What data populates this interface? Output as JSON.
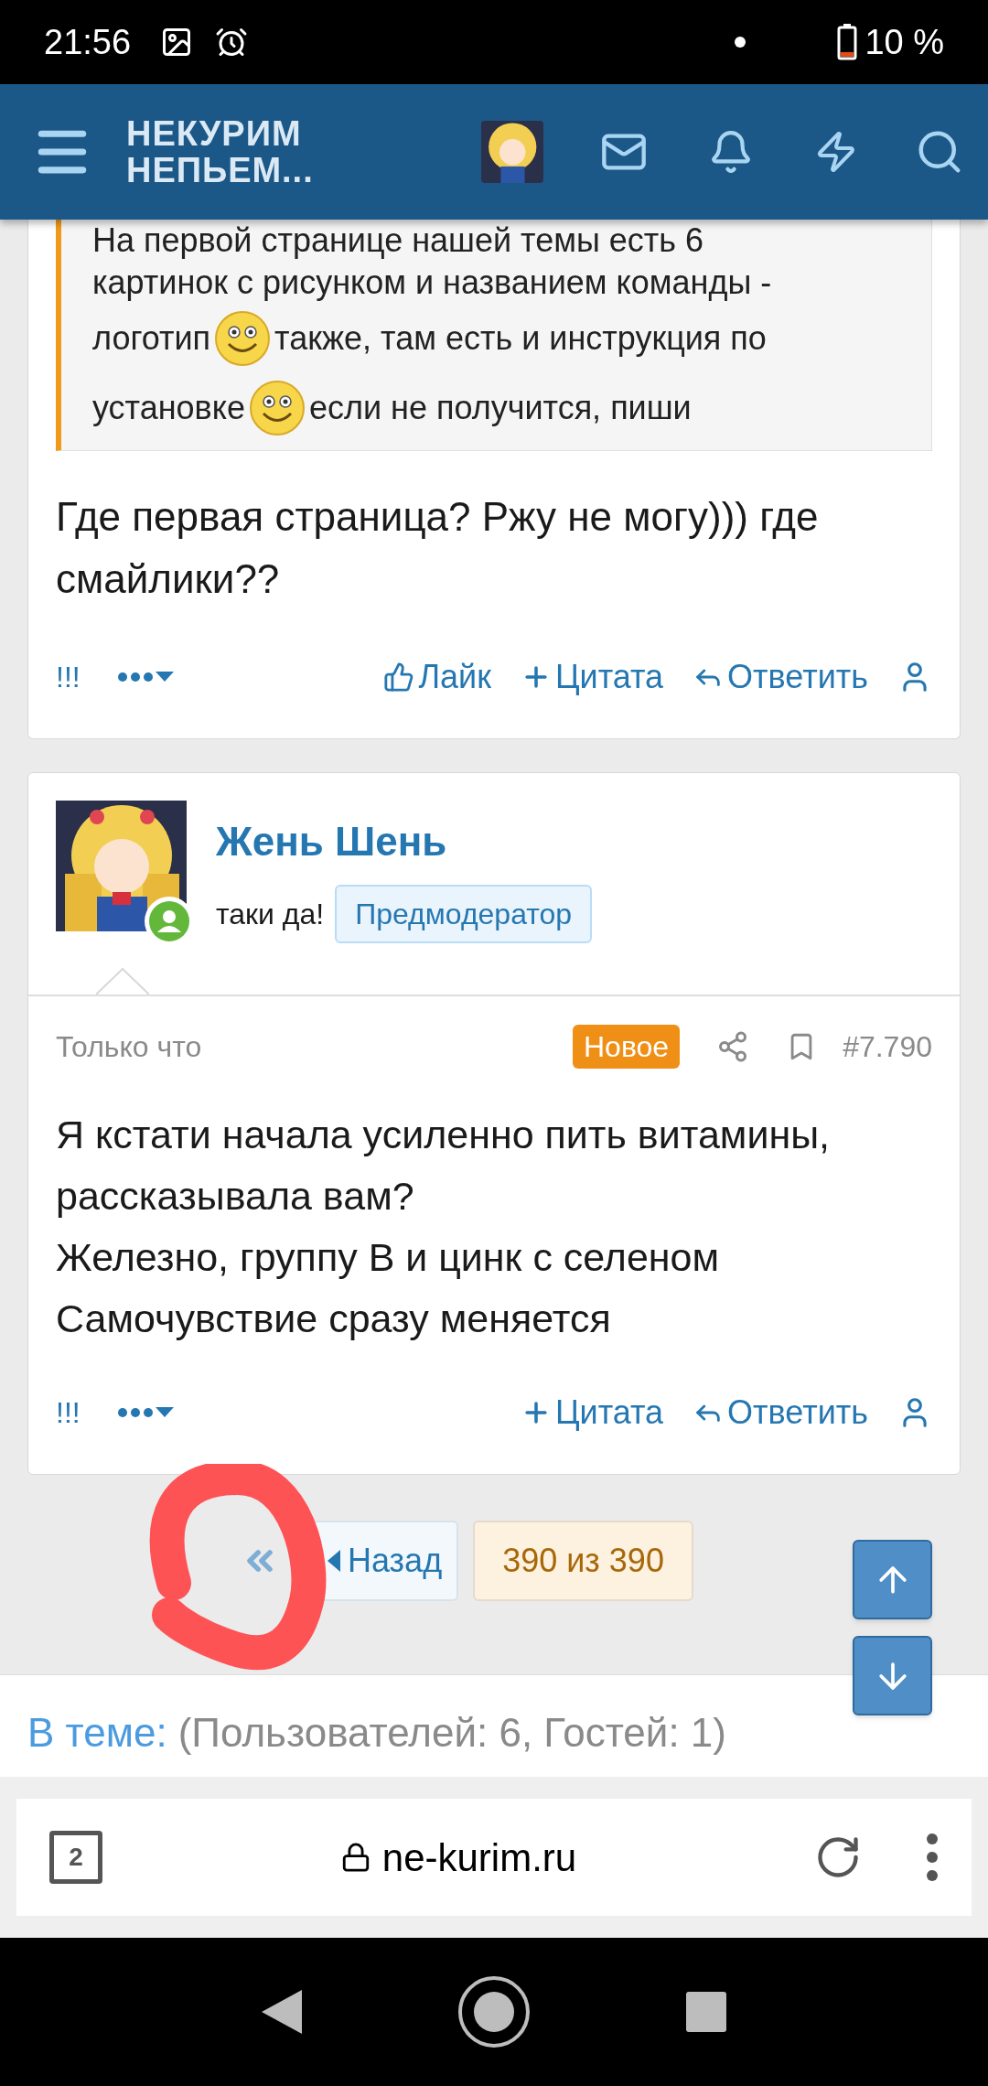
{
  "status_bar": {
    "time": "21:56",
    "battery": "10 %"
  },
  "header": {
    "title_lines": [
      "НЕКУРИМ",
      "НЕПЬЕМ..."
    ]
  },
  "posts": [
    {
      "quote_lines": [
        [
          {
            "kind": "text",
            "text": "На первой странице нашей темы есть 6"
          }
        ],
        [
          {
            "kind": "text",
            "text": "картинок с рисунком и названием команды -"
          }
        ],
        [
          {
            "kind": "text",
            "text": "логотип"
          },
          {
            "kind": "smiley"
          },
          {
            "kind": "text",
            "text": "также, там есть и инструкция по"
          }
        ],
        [
          {
            "kind": "text",
            "text": "установке"
          },
          {
            "kind": "smiley"
          },
          {
            "kind": "text",
            "text": "если не получится, пиши"
          }
        ]
      ],
      "body": "Где первая страница? Ржу не могу))) где смайлики??",
      "actions": [
        {
          "kind": "report",
          "text": "!!!"
        },
        {
          "kind": "more"
        },
        {
          "kind": "like",
          "text": "Лайк"
        },
        {
          "kind": "quote",
          "text": "Цитата"
        },
        {
          "kind": "reply",
          "text": "Ответить"
        },
        {
          "kind": "user"
        }
      ]
    },
    {
      "author": "Жень Шень",
      "user_title": "таки да!",
      "badge": "Предмодератор",
      "online": true,
      "time": "Только что",
      "new_label": "Новое",
      "number": "#7.790",
      "body": "Я кстати начала усиленно пить витамины, рассказывала вам?\nЖелезно, группу B и цинк с селеном\nСамочувствие сразу меняется",
      "actions": [
        {
          "kind": "report",
          "text": "!!!"
        },
        {
          "kind": "more"
        },
        {
          "kind": "quote",
          "text": "Цитата"
        },
        {
          "kind": "reply",
          "text": "Ответить"
        },
        {
          "kind": "user"
        }
      ]
    }
  ],
  "pagination": {
    "back": "Назад",
    "page": "390 из 390"
  },
  "online": {
    "label": "В теме:",
    "counts": "(Пользователей: 6, Гостей: 1)"
  },
  "browser": {
    "tabs": "2",
    "url": "ne-kurim.ru"
  }
}
